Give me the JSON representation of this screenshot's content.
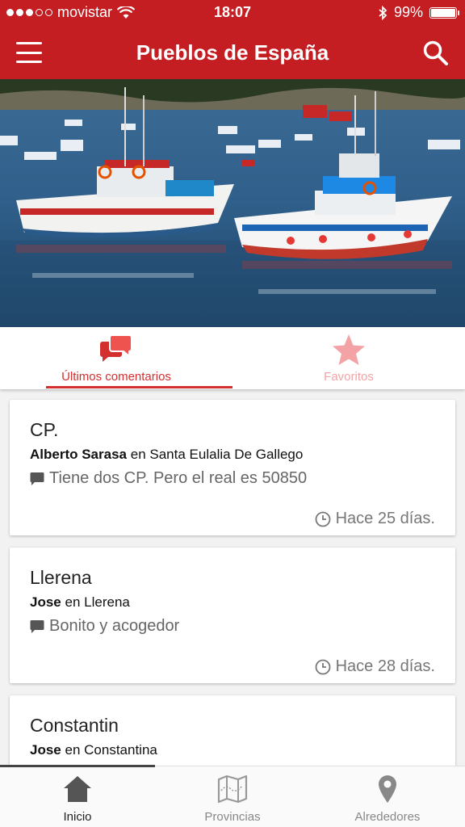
{
  "status_bar": {
    "carrier": "movistar",
    "time": "18:07",
    "battery": "99%"
  },
  "app_bar": {
    "title": "Pueblos de España",
    "menu_icon": "hamburger-menu-icon",
    "search_icon": "search-icon"
  },
  "tabs": [
    {
      "label": "Últimos comentarios",
      "icon": "comments-icon",
      "active": true
    },
    {
      "label": "Favoritos",
      "icon": "star-icon",
      "active": false
    }
  ],
  "comments": [
    {
      "title": "CP.",
      "user": "Alberto Sarasa",
      "connector": "en",
      "place": "Santa Eulalia De Gallego",
      "text": "Tiene dos CP. Pero el real es 50850",
      "time": "Hace 25 días."
    },
    {
      "title": "Llerena",
      "user": "Jose",
      "connector": "en",
      "place": "Llerena",
      "text": "Bonito y acogedor",
      "time": "Hace 28 días."
    },
    {
      "title": "Constantin",
      "user": "Jose",
      "connector": "en",
      "place": "Constantina",
      "text": "",
      "time": ""
    }
  ],
  "bottom_nav": [
    {
      "label": "Inicio",
      "icon": "home-icon",
      "active": true
    },
    {
      "label": "Provincias",
      "icon": "map-icon",
      "active": false
    },
    {
      "label": "Alrededores",
      "icon": "location-pin-icon",
      "active": false
    }
  ],
  "colors": {
    "primary": "#c41d22",
    "accent": "#d32f2f",
    "inactive_tab": "#f3a3a6"
  }
}
